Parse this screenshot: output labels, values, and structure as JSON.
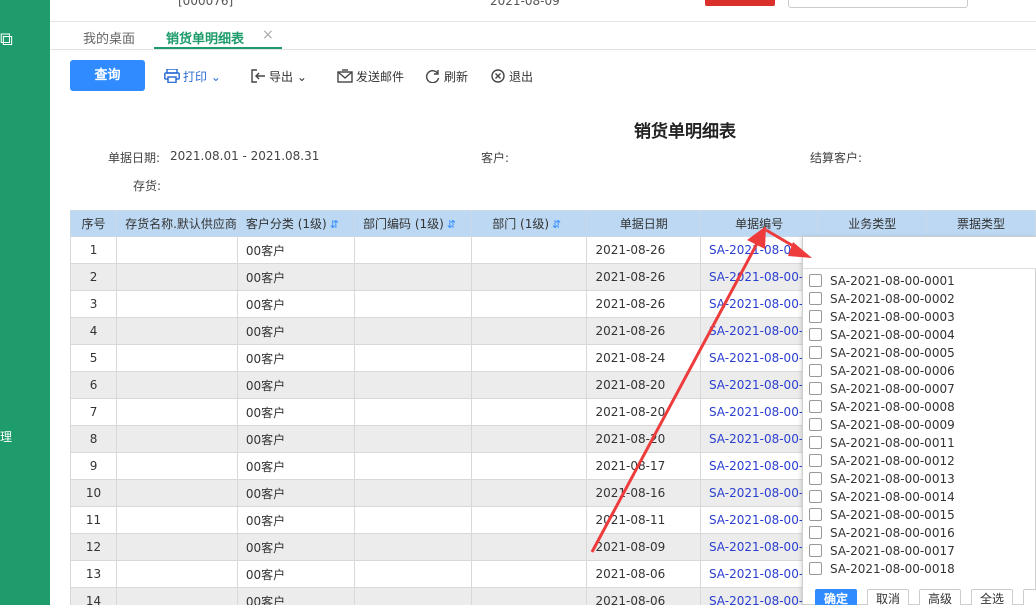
{
  "sidebar": {
    "items": [
      "理"
    ]
  },
  "topbar": {
    "crumb1": "[000076]",
    "crumb2": "2021-08-09"
  },
  "tabs": [
    {
      "label": "我的桌面"
    },
    {
      "label": "销货单明细表"
    }
  ],
  "toolbar": {
    "query": "查询",
    "print": "打印",
    "export": "导出",
    "send_mail": "发送邮件",
    "refresh": "刷新",
    "exit": "退出"
  },
  "report": {
    "title": "销货单明细表",
    "date_label": "单据日期:",
    "date_range": "2021.08.01 - 2021.08.31",
    "customer_label": "客户:",
    "settle_customer_label": "结算客户:",
    "stock_label": "存货:"
  },
  "table": {
    "headers": [
      "序号",
      "存货名称.默认供应商",
      "客户分类 (1级)",
      "部门编码 (1级)",
      "部门 (1级)",
      "单据日期",
      "单据编号",
      "业务类型",
      "票据类型"
    ],
    "rows": [
      [
        "1",
        "",
        "00客户",
        "",
        "",
        "2021-08-26",
        "SA-2021-08-00-"
      ],
      [
        "2",
        "",
        "00客户",
        "",
        "",
        "2021-08-26",
        "SA-2021-08-00-"
      ],
      [
        "3",
        "",
        "00客户",
        "",
        "",
        "2021-08-26",
        "SA-2021-08-00-"
      ],
      [
        "4",
        "",
        "00客户",
        "",
        "",
        "2021-08-26",
        "SA-2021-08-00-"
      ],
      [
        "5",
        "",
        "00客户",
        "",
        "",
        "2021-08-24",
        "SA-2021-08-00-"
      ],
      [
        "6",
        "",
        "00客户",
        "",
        "",
        "2021-08-20",
        "SA-2021-08-00-"
      ],
      [
        "7",
        "",
        "00客户",
        "",
        "",
        "2021-08-20",
        "SA-2021-08-00-"
      ],
      [
        "8",
        "",
        "00客户",
        "",
        "",
        "2021-08-20",
        "SA-2021-08-00-"
      ],
      [
        "9",
        "",
        "00客户",
        "",
        "",
        "2021-08-17",
        "SA-2021-08-00-"
      ],
      [
        "10",
        "",
        "00客户",
        "",
        "",
        "2021-08-16",
        "SA-2021-08-00-"
      ],
      [
        "11",
        "",
        "00客户",
        "",
        "",
        "2021-08-11",
        "SA-2021-08-00-"
      ],
      [
        "12",
        "",
        "00客户",
        "",
        "",
        "2021-08-09",
        "SA-2021-08-00-"
      ],
      [
        "13",
        "",
        "00客户",
        "",
        "",
        "2021-08-06",
        "SA-2021-08-00-"
      ],
      [
        "14",
        "",
        "00客户",
        "",
        "",
        "2021-08-06",
        "SA-2021-08-00-"
      ]
    ]
  },
  "filter": {
    "search_value": "",
    "options": [
      "SA-2021-08-00-0001",
      "SA-2021-08-00-0002",
      "SA-2021-08-00-0003",
      "SA-2021-08-00-0004",
      "SA-2021-08-00-0005",
      "SA-2021-08-00-0006",
      "SA-2021-08-00-0007",
      "SA-2021-08-00-0008",
      "SA-2021-08-00-0009",
      "SA-2021-08-00-0011",
      "SA-2021-08-00-0012",
      "SA-2021-08-00-0013",
      "SA-2021-08-00-0014",
      "SA-2021-08-00-0015",
      "SA-2021-08-00-0016",
      "SA-2021-08-00-0017",
      "SA-2021-08-00-0018"
    ],
    "buttons": {
      "ok": "确定",
      "cancel": "取消",
      "advanced": "高级",
      "select_all": "全选"
    }
  },
  "colors": {
    "brand_green": "#1e9c6b",
    "primary_blue": "#2f8bff",
    "annotation_red": "#ee3b3b"
  }
}
